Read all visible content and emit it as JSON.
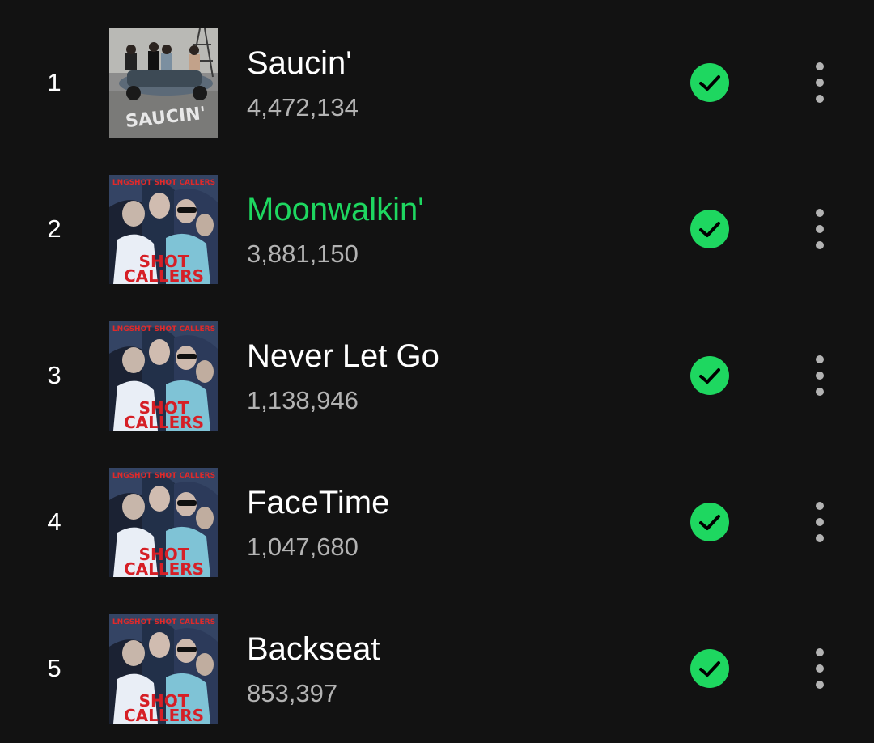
{
  "accent_color": "#1ed760",
  "tracks": [
    {
      "rank": "1",
      "title": "Saucin'",
      "plays": "4,472,134",
      "cover": "saucin",
      "cover_text": "SAUCIN'",
      "playing": false,
      "downloaded": true
    },
    {
      "rank": "2",
      "title": "Moonwalkin'",
      "plays": "3,881,150",
      "cover": "shot-callers",
      "cover_text": "LNGSHOT SHOT CALLERS",
      "playing": true,
      "downloaded": true
    },
    {
      "rank": "3",
      "title": "Never Let Go",
      "plays": "1,138,946",
      "cover": "shot-callers",
      "cover_text": "LNGSHOT SHOT CALLERS",
      "playing": false,
      "downloaded": true
    },
    {
      "rank": "4",
      "title": "FaceTime",
      "plays": "1,047,680",
      "cover": "shot-callers",
      "cover_text": "LNGSHOT SHOT CALLERS",
      "playing": false,
      "downloaded": true
    },
    {
      "rank": "5",
      "title": "Backseat",
      "plays": "853,397",
      "cover": "shot-callers",
      "cover_text": "LNGSHOT SHOT CALLERS",
      "playing": false,
      "downloaded": true
    }
  ],
  "icons": {
    "downloaded": "check-circle-icon",
    "more": "more-vertical-icon"
  }
}
